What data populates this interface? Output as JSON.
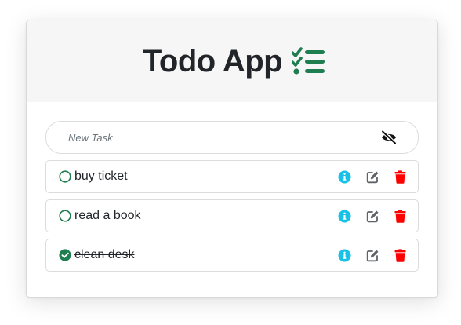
{
  "app": {
    "title": "Todo App",
    "title_icon": "list-check-icon",
    "accent_color": "#1e7e4f"
  },
  "new_task": {
    "placeholder": "New Task",
    "value": "",
    "toggle_icon": "eye-slash-icon"
  },
  "tasks": [
    {
      "label": "buy ticket",
      "completed": false
    },
    {
      "label": "read a book",
      "completed": false
    },
    {
      "label": "clean desk",
      "completed": true
    }
  ],
  "actions": {
    "info_icon": "info-circle-icon",
    "info_color": "#17c1e8",
    "edit_icon": "edit-icon",
    "edit_color": "#5f6368",
    "delete_icon": "trash-icon",
    "delete_color": "#ff0000"
  }
}
